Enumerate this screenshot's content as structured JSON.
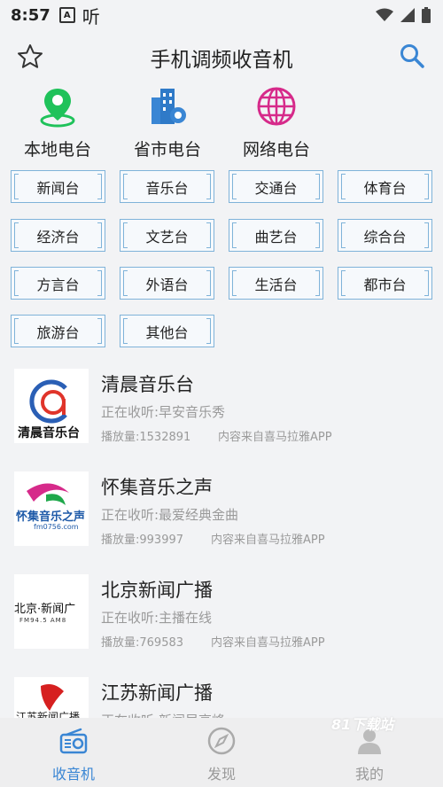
{
  "status_bar": {
    "time": "8:57",
    "app_badge": "A",
    "notice": "听"
  },
  "header": {
    "title": "手机调频收音机"
  },
  "categories": [
    {
      "label": "本地电台",
      "icon": "location-pin-icon"
    },
    {
      "label": "省市电台",
      "icon": "city-building-icon"
    },
    {
      "label": "网络电台",
      "icon": "globe-icon"
    }
  ],
  "channel_types": [
    "新闻台",
    "音乐台",
    "交通台",
    "体育台",
    "经济台",
    "文艺台",
    "曲艺台",
    "综合台",
    "方言台",
    "外语台",
    "生活台",
    "都市台",
    "旅游台",
    "其他台"
  ],
  "stations": [
    {
      "name": "清晨音乐台",
      "playing": "正在收听:早安音乐秀",
      "plays": "播放量:1532891",
      "source": "内容来自喜马拉雅APP",
      "logo_text": "清晨音乐台"
    },
    {
      "name": "怀集音乐之声",
      "playing": "正在收听:最爱经典金曲",
      "plays": "播放量:993997",
      "source": "内容来自喜马拉雅APP",
      "logo_text": "怀集音乐之声",
      "logo_sub": "fm0756.com"
    },
    {
      "name": "北京新闻广播",
      "playing": "正在收听:主播在线",
      "plays": "播放量:769583",
      "source": "内容来自喜马拉雅APP",
      "logo_text": "北京·新闻广",
      "logo_sub": "FM94.5 AM8"
    },
    {
      "name": "江苏新闻广播",
      "playing": "正在收听:新闻早高峰",
      "plays": "",
      "source": "",
      "logo_text": "江苏新闻广播"
    }
  ],
  "tabs": [
    {
      "label": "收音机",
      "icon": "radio-icon",
      "active": true
    },
    {
      "label": "发现",
      "icon": "compass-icon",
      "active": false
    },
    {
      "label": "我的",
      "icon": "user-icon",
      "active": false
    }
  ],
  "watermark": "81下载站",
  "colors": {
    "accent": "#3a86d4",
    "chip_border": "#7fb3d9",
    "green": "#1fc25a",
    "magenta": "#d62a8a"
  }
}
